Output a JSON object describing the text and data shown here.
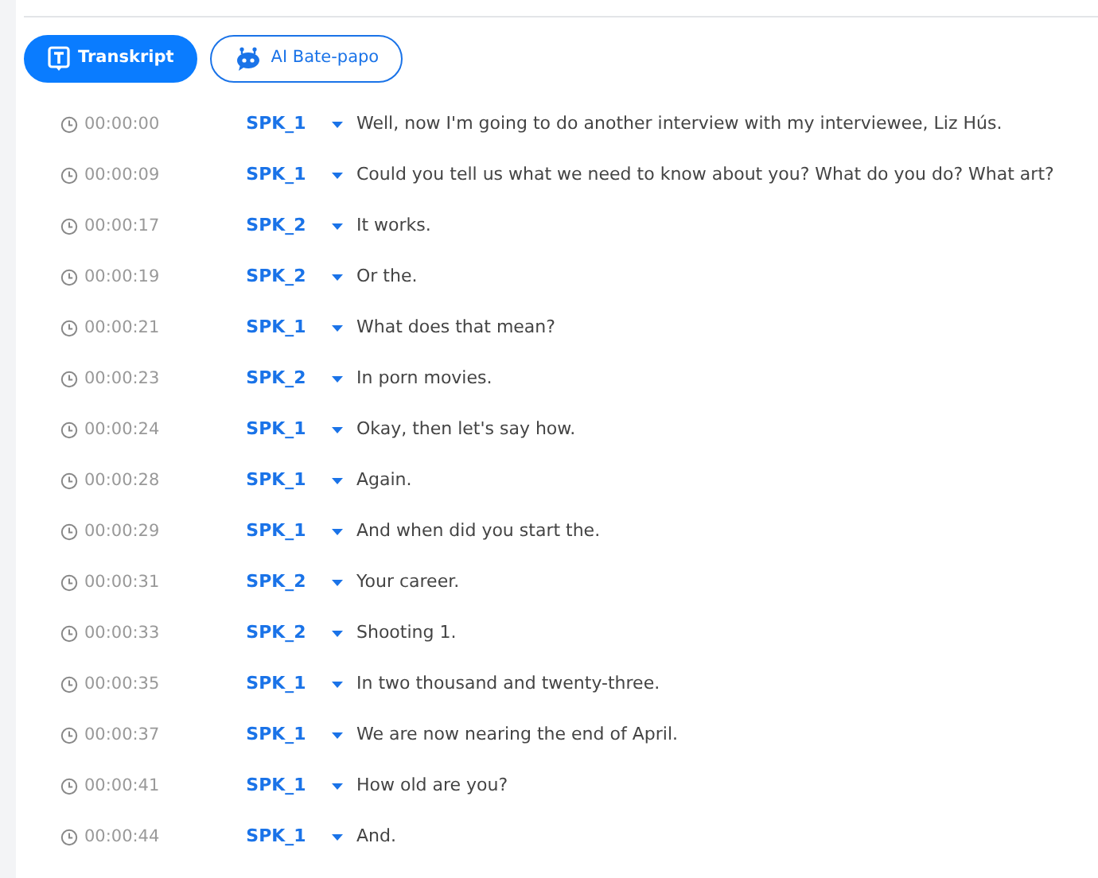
{
  "tabs": [
    {
      "label": "Transkript",
      "kind": "transcript",
      "selected": true
    },
    {
      "label": "AI Bate-papo",
      "kind": "chat",
      "selected": false
    }
  ],
  "segments": [
    {
      "time": "00:00:00",
      "speaker": "SPK_1",
      "text": "Well, now I'm going to do another interview with my interviewee, Liz Hús."
    },
    {
      "time": "00:00:09",
      "speaker": "SPK_1",
      "text": "Could you tell us what we need to know about you? What do you do? What art?"
    },
    {
      "time": "00:00:17",
      "speaker": "SPK_2",
      "text": "It works."
    },
    {
      "time": "00:00:19",
      "speaker": "SPK_2",
      "text": "Or the."
    },
    {
      "time": "00:00:21",
      "speaker": "SPK_1",
      "text": "What does that mean?"
    },
    {
      "time": "00:00:23",
      "speaker": "SPK_2",
      "text": "In porn movies."
    },
    {
      "time": "00:00:24",
      "speaker": "SPK_1",
      "text": "Okay, then let's say how."
    },
    {
      "time": "00:00:28",
      "speaker": "SPK_1",
      "text": "Again."
    },
    {
      "time": "00:00:29",
      "speaker": "SPK_1",
      "text": "And when did you start the."
    },
    {
      "time": "00:00:31",
      "speaker": "SPK_2",
      "text": "Your career."
    },
    {
      "time": "00:00:33",
      "speaker": "SPK_2",
      "text": "Shooting 1."
    },
    {
      "time": "00:00:35",
      "speaker": "SPK_1",
      "text": "In two thousand and twenty-three."
    },
    {
      "time": "00:00:37",
      "speaker": "SPK_1",
      "text": "We are now nearing the end of April."
    },
    {
      "time": "00:00:41",
      "speaker": "SPK_1",
      "text": "How old are you?"
    },
    {
      "time": "00:00:44",
      "speaker": "SPK_1",
      "text": "And."
    }
  ]
}
